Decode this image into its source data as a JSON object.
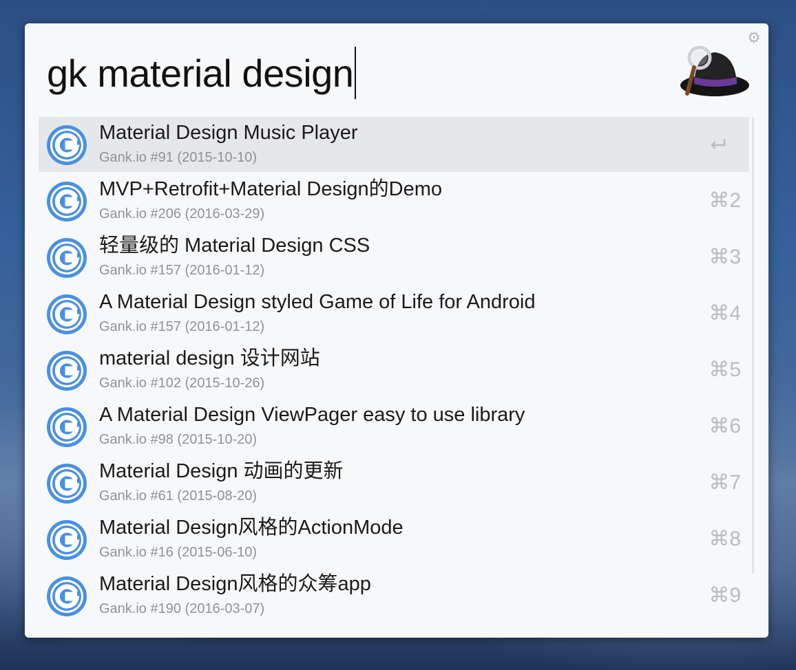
{
  "search": {
    "query": "gk material design"
  },
  "results": [
    {
      "title": "Material Design Music Player",
      "subtitle": "Gank.io #91 (2015-10-10)",
      "shortcut": "↩"
    },
    {
      "title": "MVP+Retrofit+Material Design的Demo",
      "subtitle": "Gank.io #206 (2016-03-29)",
      "shortcut": "⌘2"
    },
    {
      "title": "轻量级的 Material Design CSS",
      "subtitle": "Gank.io #157 (2016-01-12)",
      "shortcut": "⌘3"
    },
    {
      "title": "A Material Design styled Game of Life for Android",
      "subtitle": "Gank.io #157 (2016-01-12)",
      "shortcut": "⌘4"
    },
    {
      "title": "material design 设计网站",
      "subtitle": "Gank.io #102 (2015-10-26)",
      "shortcut": "⌘5"
    },
    {
      "title": "A Material Design ViewPager easy to use library",
      "subtitle": "Gank.io #98 (2015-10-20)",
      "shortcut": "⌘6"
    },
    {
      "title": "Material Design 动画的更新",
      "subtitle": "Gank.io #61 (2015-08-20)",
      "shortcut": "⌘7"
    },
    {
      "title": "Material Design风格的ActionMode",
      "subtitle": "Gank.io #16 (2015-06-10)",
      "shortcut": "⌘8"
    },
    {
      "title": " Material Design风格的众筹app",
      "subtitle": "Gank.io #190 (2016-03-07)",
      "shortcut": "⌘9"
    }
  ],
  "icons": {
    "result": "gank-g-icon",
    "settings": "gear-icon",
    "app": "alfred-hat-logo",
    "selected_action": "return-icon"
  },
  "colors": {
    "icon_blue": "#4a90e2",
    "selection": "#e6e7ea",
    "subtitle": "#8f9196"
  }
}
